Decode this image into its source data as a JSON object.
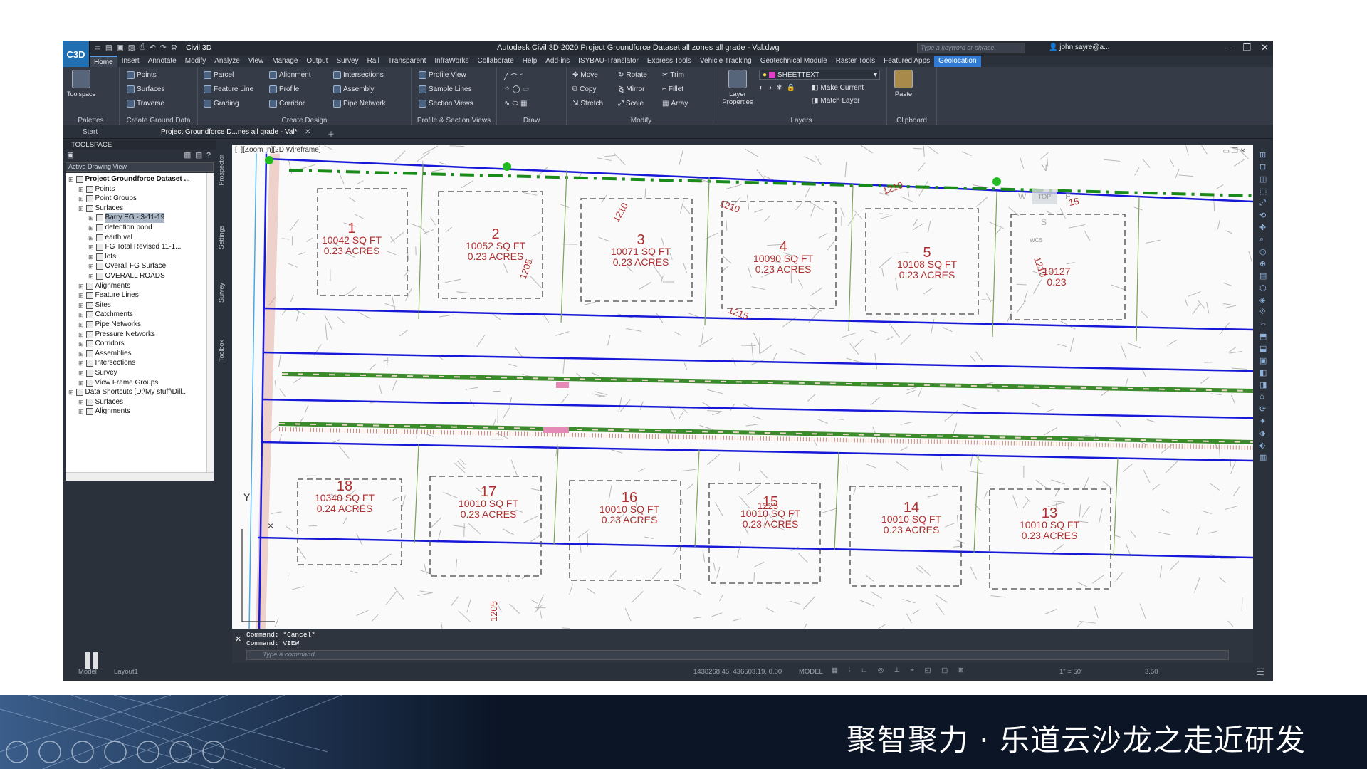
{
  "window": {
    "app_short": "C3D",
    "workspace": "Civil 3D",
    "title": "Autodesk Civil 3D 2020   Project Groundforce Dataset all zones all grade - Val.dwg",
    "search_placeholder": "Type a keyword or phrase",
    "user": "john.sayre@a..."
  },
  "menu": [
    "Home",
    "Insert",
    "Annotate",
    "Modify",
    "Analyze",
    "View",
    "Manage",
    "Output",
    "Survey",
    "Rail",
    "Transparent",
    "InfraWorks",
    "Collaborate",
    "Help",
    "Add-ins",
    "ISYBAU-Translator",
    "Express Tools",
    "Vehicle Tracking",
    "Geotechnical Module",
    "Raster Tools",
    "Featured Apps",
    "Geolocation"
  ],
  "ribbon": {
    "palettes": {
      "title": "Palettes",
      "toolspace": "Toolspace"
    },
    "ground": {
      "title": "Create Ground Data",
      "points": "Points",
      "surfaces": "Surfaces",
      "traverse": "Traverse"
    },
    "design": {
      "title": "Create Design",
      "parcel": "Parcel",
      "feature_line": "Feature Line",
      "grading": "Grading",
      "alignment": "Alignment",
      "profile": "Profile",
      "corridor": "Corridor",
      "intersections": "Intersections",
      "assembly": "Assembly",
      "pipe_network": "Pipe Network"
    },
    "profile": {
      "title": "Profile & Section Views",
      "profile_view": "Profile View",
      "sample_lines": "Sample Lines",
      "section_views": "Section Views"
    },
    "draw": {
      "title": "Draw"
    },
    "modify": {
      "title": "Modify",
      "move": "Move",
      "rotate": "Rotate",
      "trim": "Trim",
      "copy": "Copy",
      "mirror": "Mirror",
      "fillet": "Fillet",
      "stretch": "Stretch",
      "scale": "Scale",
      "array": "Array"
    },
    "layers": {
      "title": "Layers",
      "layer_properties": "Layer Properties",
      "layer_name": "SHEETTEXT",
      "make_current": "Make Current",
      "match_layer": "Match Layer"
    },
    "clipboard": {
      "title": "Clipboard",
      "paste": "Paste"
    }
  },
  "doc_tabs": {
    "start": "Start",
    "active": "Project Groundforce D...nes all grade - Val*"
  },
  "toolspace": {
    "title": "TOOLSPACE",
    "view_combo": "Active Drawing View",
    "tree": [
      {
        "label": "Project Groundforce Dataset ...",
        "level": 0,
        "bold": true
      },
      {
        "label": "Points",
        "level": 1
      },
      {
        "label": "Point Groups",
        "level": 1
      },
      {
        "label": "Surfaces",
        "level": 1
      },
      {
        "label": "Barry EG - 3-11-19",
        "level": 2,
        "selected": true
      },
      {
        "label": "detention pond",
        "level": 2
      },
      {
        "label": "earth val",
        "level": 2
      },
      {
        "label": "FG Total Revised 11-1...",
        "level": 2
      },
      {
        "label": "lots",
        "level": 2
      },
      {
        "label": "Overall FG Surface",
        "level": 2
      },
      {
        "label": "OVERALL ROADS",
        "level": 2
      },
      {
        "label": "Alignments",
        "level": 1
      },
      {
        "label": "Feature Lines",
        "level": 1
      },
      {
        "label": "Sites",
        "level": 1
      },
      {
        "label": "Catchments",
        "level": 1
      },
      {
        "label": "Pipe Networks",
        "level": 1
      },
      {
        "label": "Pressure Networks",
        "level": 1
      },
      {
        "label": "Corridors",
        "level": 1
      },
      {
        "label": "Assemblies",
        "level": 1
      },
      {
        "label": "Intersections",
        "level": 1
      },
      {
        "label": "Survey",
        "level": 1
      },
      {
        "label": "View Frame Groups",
        "level": 1
      },
      {
        "label": "Data Shortcuts [D:\\My stuff\\Dill...",
        "level": 0
      },
      {
        "label": "Surfaces",
        "level": 1
      },
      {
        "label": "Alignments",
        "level": 1
      }
    ],
    "side_tabs": [
      "Prospector",
      "Settings",
      "Survey",
      "Toolbox"
    ]
  },
  "viewport": {
    "label": "[–][Zoom In][2D Wireframe]",
    "viewcube": {
      "top": "TOP",
      "n": "N",
      "s": "S",
      "w": "W",
      "e": "E",
      "wcs": "WCS"
    },
    "lots": [
      {
        "num": "1",
        "area": "10042 SQ FT",
        "acres": "0.23 ACRES"
      },
      {
        "num": "2",
        "area": "10052 SQ FT",
        "acres": "0.23 ACRES"
      },
      {
        "num": "3",
        "area": "10071 SQ FT",
        "acres": "0.23 ACRES"
      },
      {
        "num": "4",
        "area": "10090 SQ FT",
        "acres": "0.23 ACRES"
      },
      {
        "num": "5",
        "area": "10108 SQ FT",
        "acres": "0.23 ACRES"
      },
      {
        "num": "",
        "area": "10127",
        "acres": "0.23"
      },
      {
        "num": "18",
        "area": "10340 SQ FT",
        "acres": "0.24 ACRES"
      },
      {
        "num": "17",
        "area": "10010 SQ FT",
        "acres": "0.23 ACRES"
      },
      {
        "num": "16",
        "area": "10010 SQ FT",
        "acres": "0.23 ACRES"
      },
      {
        "num": "15",
        "area": "10010 SQ FT",
        "acres": "0.23 ACRES"
      },
      {
        "num": "14",
        "area": "10010 SQ FT",
        "acres": "0.23 ACRES"
      },
      {
        "num": "13",
        "area": "10010 SQ FT",
        "acres": "0.23 ACRES"
      }
    ],
    "contours": [
      "1210",
      "1205",
      "1210",
      "1215",
      "1210",
      "1210",
      "1225",
      "1205",
      "15"
    ],
    "ucs": "Y"
  },
  "command": {
    "history1": "Command: *Cancel*",
    "history2": "Command: VIEW",
    "placeholder": "Type a command"
  },
  "status": {
    "coords": "1438268.45, 436503.19, 0.00",
    "model": "MODEL",
    "tab_model": "Model",
    "tab_layout": "Layout1",
    "scale": "1\" = 50'",
    "lineweight": "3.50"
  },
  "banner": {
    "text": "聚智聚力 · 乐道云沙龙之走近研发"
  }
}
